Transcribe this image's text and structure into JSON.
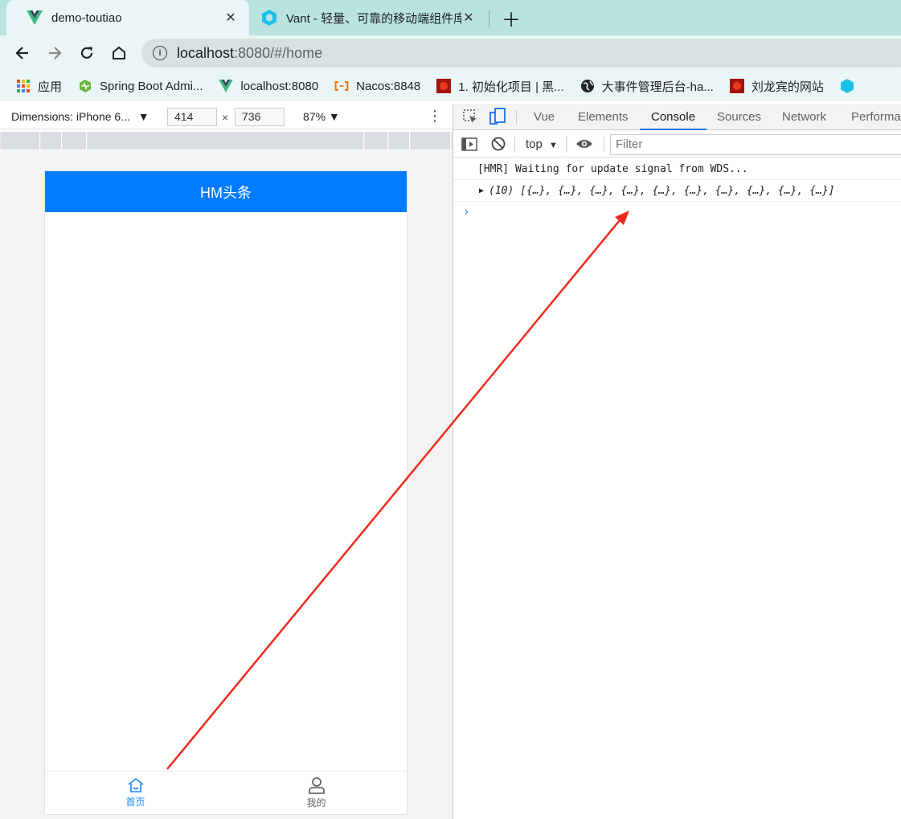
{
  "browser": {
    "tabs": [
      {
        "title": "demo-toutiao",
        "icon": "vue-logo-icon",
        "active": true
      },
      {
        "title": "Vant - 轻量、可靠的移动端组件库",
        "icon": "vant-logo-icon",
        "active": false
      }
    ],
    "address": {
      "host": "localhost",
      "rest": ":8080/#/home"
    },
    "bookmarks": [
      {
        "label": "应用",
        "icon": "apps-grid-icon"
      },
      {
        "label": "Spring Boot Admi...",
        "icon": "spring-boot-admin-icon"
      },
      {
        "label": "localhost:8080",
        "icon": "vue-logo-icon"
      },
      {
        "label": "Nacos:8848",
        "icon": "alibaba-cloud-icon"
      },
      {
        "label": "1. 初始化项目 | 黑...",
        "icon": "red-site-icon"
      },
      {
        "label": "大事件管理后台-ha...",
        "icon": "globe-icon"
      },
      {
        "label": "刘龙宾的网站",
        "icon": "red-site-icon"
      }
    ]
  },
  "device": {
    "dimensions_label": "Dimensions: iPhone 6...",
    "width_value": "414",
    "times": "×",
    "height_value": "736",
    "zoom": "87%"
  },
  "app": {
    "title": "HM头条",
    "tabbar": [
      {
        "label": "首页",
        "icon": "home-icon",
        "active": true
      },
      {
        "label": "我的",
        "icon": "user-icon",
        "active": false
      }
    ],
    "accent": "#007bff"
  },
  "devtools": {
    "tabs": [
      "Vue",
      "Elements",
      "Console",
      "Sources",
      "Network",
      "Performa"
    ],
    "active_tab": "Console",
    "context": "top",
    "filter_placeholder": "Filter",
    "logs": [
      "[HMR] Waiting for update signal from WDS...",
      "(10) [{…}, {…}, {…}, {…}, {…}, {…}, {…}, {…}, {…}, {…}]"
    ]
  },
  "annotation": {
    "color": "#f02a1d"
  }
}
